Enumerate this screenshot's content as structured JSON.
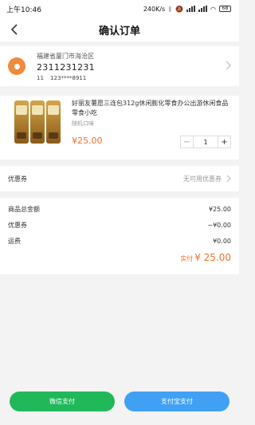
{
  "status_bar": {
    "time": "上午10:46",
    "network_speed": "240K/s",
    "battery": "68"
  },
  "header": {
    "title": "确认订单"
  },
  "address": {
    "region": "福建省厦门市海沧区",
    "detail": "2311231231",
    "contact_name": "11",
    "contact_phone": "123****8911"
  },
  "product": {
    "name": "好丽友薯愿三连包312g休闲膨化零食办公出游休闲食品零食小吃",
    "spec": "随机口味",
    "price": "¥25.00",
    "quantity": "1",
    "minus_symbol": "−",
    "plus_symbol": "+"
  },
  "coupon": {
    "label": "优惠券",
    "value": "无可用优惠券"
  },
  "summary": {
    "rows": [
      {
        "label": "商品总金额",
        "value": "¥25.00"
      },
      {
        "label": "优惠券",
        "value": "−¥0.00"
      },
      {
        "label": "运费",
        "value": "¥0.00"
      }
    ],
    "paid_label": "实付",
    "paid_amount": "¥ 25.00"
  },
  "payment": {
    "wechat_label": "微信支付",
    "alipay_label": "支付宝支付"
  },
  "colors": {
    "accent": "#f0702b",
    "wechat": "#21b85a",
    "alipay": "#3fa0f4"
  }
}
